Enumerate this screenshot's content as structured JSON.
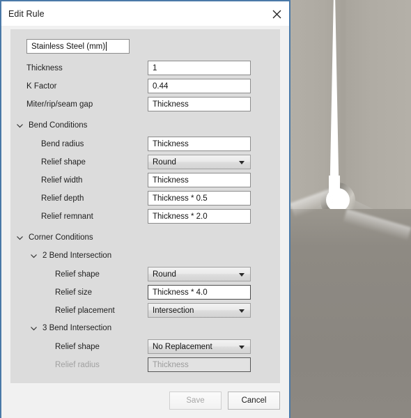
{
  "window": {
    "title": "Edit Rule",
    "close_icon": "close-icon",
    "accent_border": "#4a79a8"
  },
  "rule": {
    "name_value": "Stainless Steel (mm)",
    "name_placeholder": "Rule name"
  },
  "top_fields": [
    {
      "label": "Thickness",
      "type": "text",
      "value": "1"
    },
    {
      "label": "K Factor",
      "type": "text",
      "value": "0.44"
    },
    {
      "label": "Miter/rip/seam gap",
      "type": "text",
      "value": "Thickness"
    }
  ],
  "bend_conditions": {
    "title": "Bend Conditions",
    "expanded": true,
    "chevron_icon": "chevron-down-icon",
    "fields": [
      {
        "label": "Bend radius",
        "type": "text",
        "value": "Thickness"
      },
      {
        "label": "Relief shape",
        "type": "select",
        "value": "Round"
      },
      {
        "label": "Relief width",
        "type": "text",
        "value": "Thickness"
      },
      {
        "label": "Relief depth",
        "type": "text",
        "value": "Thickness * 0.5"
      },
      {
        "label": "Relief remnant",
        "type": "text",
        "value": "Thickness * 2.0"
      }
    ]
  },
  "corner_conditions": {
    "title": "Corner Conditions",
    "expanded": true,
    "chevron_icon": "chevron-down-icon",
    "subgroups": [
      {
        "title": "2 Bend Intersection",
        "expanded": true,
        "chevron_icon": "chevron-down-icon",
        "fields": [
          {
            "label": "Relief shape",
            "type": "select",
            "value": "Round"
          },
          {
            "label": "Relief size",
            "type": "text",
            "value": "Thickness * 4.0",
            "focused": true
          },
          {
            "label": "Relief placement",
            "type": "select",
            "value": "Intersection"
          }
        ]
      },
      {
        "title": "3 Bend Intersection",
        "expanded": true,
        "chevron_icon": "chevron-down-icon",
        "fields": [
          {
            "label": "Relief shape",
            "type": "select",
            "value": "No Replacement"
          },
          {
            "label": "Relief radius",
            "type": "text",
            "value": "Thickness",
            "disabled": true
          }
        ]
      }
    ]
  },
  "footer": {
    "save_label": "Save",
    "save_disabled": true,
    "cancel_label": "Cancel"
  }
}
